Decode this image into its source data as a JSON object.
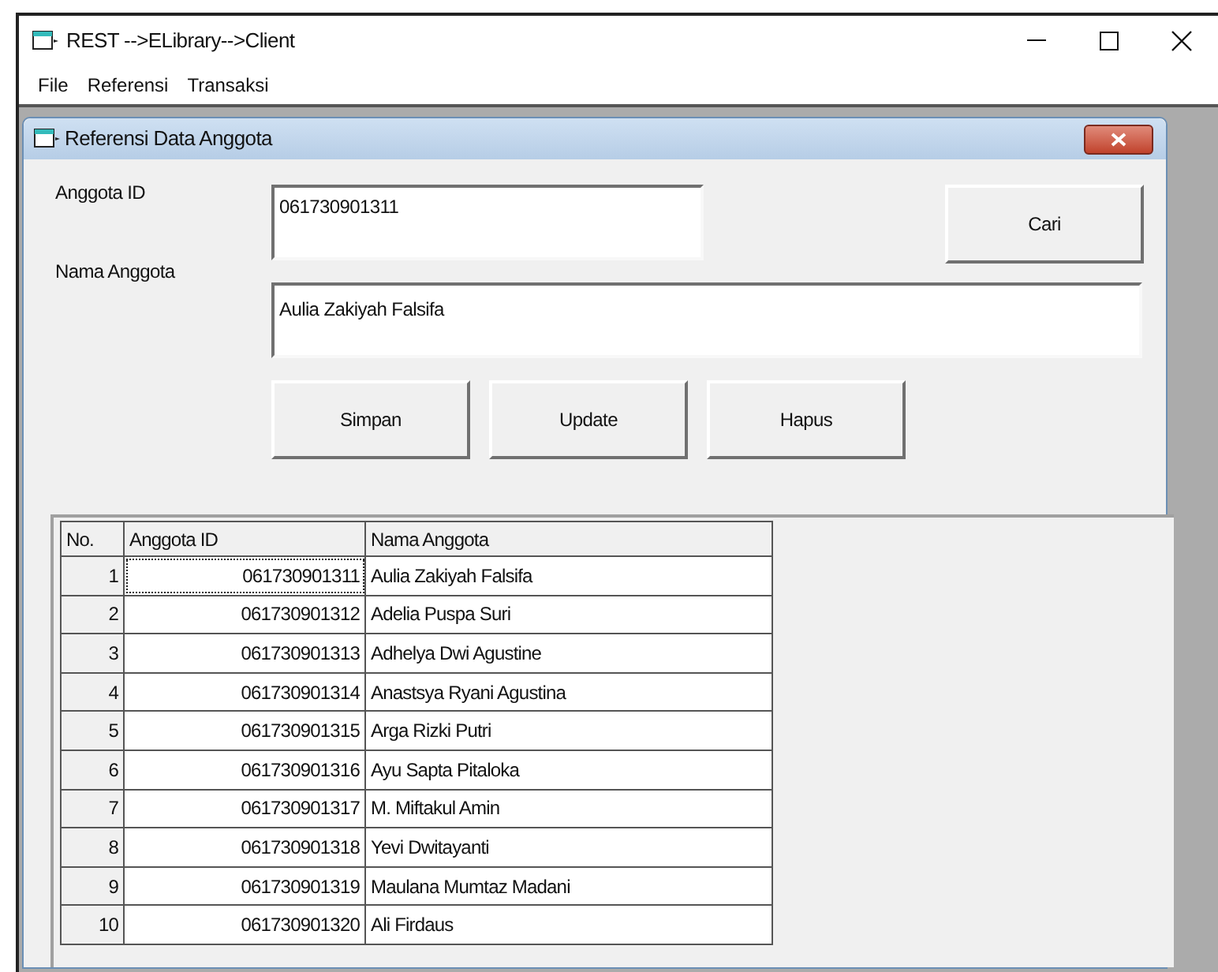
{
  "window": {
    "title": "REST -->ELibrary-->Client"
  },
  "menu": [
    "File",
    "Referensi",
    "Transaksi"
  ],
  "child_window": {
    "title": "Referensi Data Anggota"
  },
  "form": {
    "fields": [
      {
        "label": "Anggota ID",
        "value": "061730901311"
      },
      {
        "label": "Nama Anggota",
        "value": "Aulia Zakiyah Falsifa"
      }
    ],
    "search_button": "Cari",
    "buttons": [
      "Simpan",
      "Update",
      "Hapus"
    ]
  },
  "table": {
    "columns": [
      "No.",
      "Anggota ID",
      "Nama Anggota"
    ],
    "rows": [
      {
        "no": "1",
        "id": "061730901311",
        "name": "Aulia Zakiyah Falsifa",
        "selected": true
      },
      {
        "no": "2",
        "id": "061730901312",
        "name": "Adelia Puspa Suri",
        "selected": false
      },
      {
        "no": "3",
        "id": "061730901313",
        "name": "Adhelya Dwi Agustine",
        "selected": false
      },
      {
        "no": "4",
        "id": "061730901314",
        "name": "Anastsya Ryani Agustina",
        "selected": false
      },
      {
        "no": "5",
        "id": "061730901315",
        "name": "Arga Rizki Putri",
        "selected": false
      },
      {
        "no": "6",
        "id": "061730901316",
        "name": "Ayu Sapta Pitaloka",
        "selected": false
      },
      {
        "no": "7",
        "id": "061730901317",
        "name": "M. Miftakul Amin",
        "selected": false
      },
      {
        "no": "8",
        "id": "061730901318",
        "name": "Yevi Dwitayanti",
        "selected": false
      },
      {
        "no": "9",
        "id": "061730901319",
        "name": "Maulana Mumtaz Madani",
        "selected": false
      },
      {
        "no": "10",
        "id": "061730901320",
        "name": "Ali Firdaus",
        "selected": false
      }
    ]
  }
}
